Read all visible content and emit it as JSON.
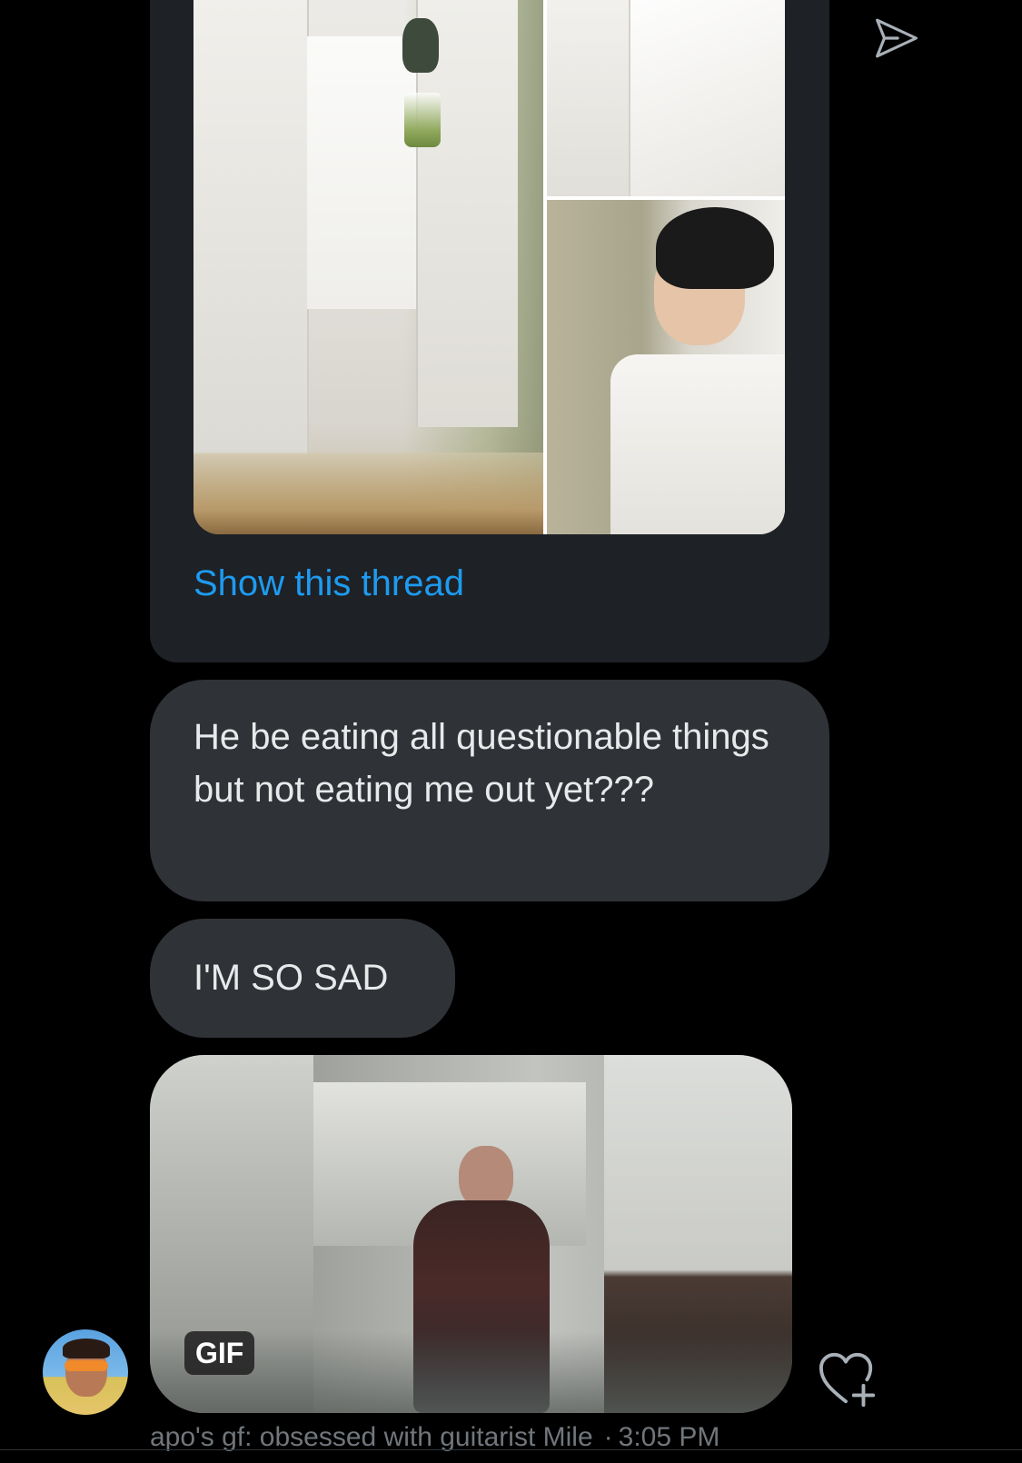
{
  "tweet_card": {
    "show_thread_label": "Show this thread"
  },
  "messages": [
    {
      "text": "He be eating all questionable things but not eating me out yet???"
    },
    {
      "text": "I'M SO SAD"
    }
  ],
  "gif": {
    "badge_label": "GIF"
  },
  "meta": {
    "sender": "apo's gf: obsessed with guitarist Mile",
    "separator": "·",
    "time": "3:05 PM"
  },
  "icons": {
    "send": "send-icon",
    "react": "heart-plus-icon"
  },
  "colors": {
    "background": "#000000",
    "bubble": "#2f3236",
    "card": "#1e2126",
    "link": "#1d9bf0",
    "meta": "#71767b",
    "icon": "#a9b0b8"
  }
}
